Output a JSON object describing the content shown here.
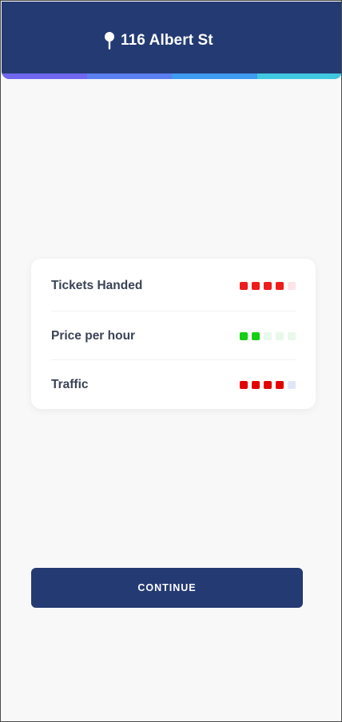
{
  "header": {
    "address": "116 Albert St",
    "icon": "map-pin-icon",
    "progress_colors": [
      "#6f67f0",
      "#5a7ff0",
      "#3f9bf0",
      "#3fc8e0"
    ]
  },
  "card": {
    "rows": [
      {
        "label": "Tickets Handed",
        "level": 4,
        "max": 5,
        "active_color": "#ee1c1c",
        "inactive_color": "#fde4e8"
      },
      {
        "label": "Price per hour",
        "level": 2,
        "max": 5,
        "active_color": "#14cf14",
        "inactive_color": "#e8f8ea"
      },
      {
        "label": "Traffic",
        "level": 4,
        "max": 5,
        "active_color": "#e50000",
        "inactive_color": "#dfe6f7"
      }
    ]
  },
  "actions": {
    "continue_label": "CONTINUE"
  }
}
